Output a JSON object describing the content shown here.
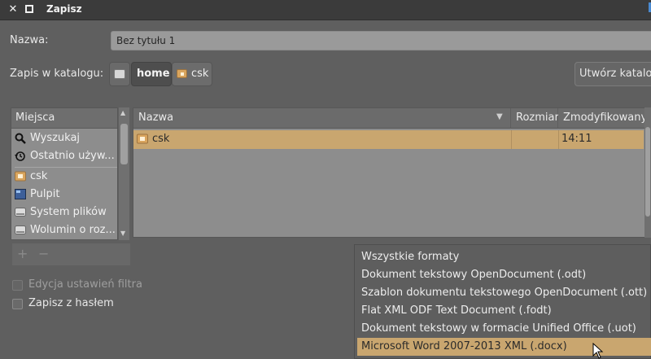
{
  "window": {
    "title": "Zapisz"
  },
  "name_field": {
    "label": "Nazwa:",
    "value": "Bez tytułu 1"
  },
  "folder": {
    "label": "Zapis w katalogu:",
    "path": [
      "home",
      "csk"
    ],
    "create_folder_label": "Utwórz katalog"
  },
  "places": {
    "header": "Miejsca",
    "items": [
      {
        "label": "Wyszukaj",
        "icon": "search-icon"
      },
      {
        "label": "Ostatnio używ...",
        "icon": "recent-icon"
      },
      {
        "label": "csk",
        "icon": "home-folder-icon"
      },
      {
        "label": "Pulpit",
        "icon": "desktop-icon"
      },
      {
        "label": "System plików",
        "icon": "drive-icon"
      },
      {
        "label": "Wolumin o roz...",
        "icon": "drive-icon"
      }
    ],
    "add_label": "+",
    "remove_label": "−"
  },
  "files": {
    "columns": [
      "Nazwa",
      "Rozmiar",
      "Zmodyfikowany"
    ],
    "rows": [
      {
        "name": "csk",
        "size": "",
        "modified": "14:11"
      }
    ]
  },
  "options": {
    "edit_filter": "Edycja ustawień filtra",
    "save_with_password": "Zapisz z hasłem"
  },
  "formats": {
    "items": [
      "Wszystkie formaty",
      "Dokument tekstowy OpenDocument (.odt)",
      "Szablon dokumentu tekstowego OpenDocument (.ott)",
      "Flat XML ODF Text Document (.fodt)",
      "Dokument tekstowy w formacie Unified Office (.uot)",
      "Microsoft Word 2007-2013 XML (.docx)"
    ],
    "selected": "Microsoft Word 2007-2013 XML (.docx)"
  }
}
